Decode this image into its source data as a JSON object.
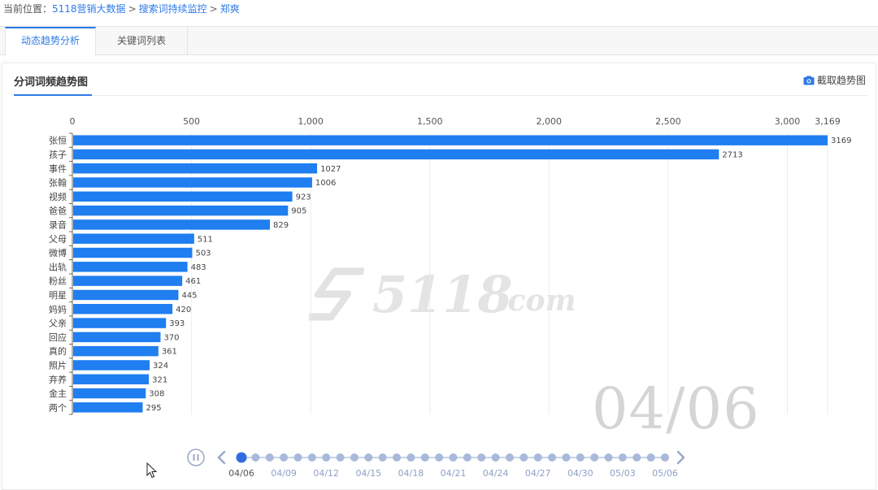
{
  "breadcrumb": {
    "prefix": "当前位置：",
    "items": [
      "5118营销大数据",
      "搜索词持续监控",
      "郑爽"
    ],
    "separator": ">"
  },
  "tabs": [
    {
      "label": "动态趋势分析",
      "active": true
    },
    {
      "label": "关键词列表",
      "active": false
    }
  ],
  "panel": {
    "title": "分词词频趋势图",
    "capture_label": "截取趋势图",
    "capture_icon": "camera-icon"
  },
  "watermark": {
    "brand": "5118",
    "suffix": ".com"
  },
  "colors": {
    "bar": "#1f7ef0",
    "accent": "#2d7ae6",
    "timeline_dot": "#a9b9da",
    "timeline_active": "#2f6de0"
  },
  "chart_data": {
    "type": "bar",
    "orientation": "horizontal",
    "categories": [
      "张恒",
      "孩子",
      "事件",
      "张翰",
      "视频",
      "爸爸",
      "录音",
      "父母",
      "微博",
      "出轨",
      "粉丝",
      "明星",
      "妈妈",
      "父亲",
      "回应",
      "真的",
      "照片",
      "弃养",
      "金主",
      "两个"
    ],
    "values": [
      3169,
      2713,
      1027,
      1006,
      923,
      905,
      829,
      511,
      503,
      483,
      461,
      445,
      420,
      393,
      370,
      361,
      324,
      321,
      308,
      295
    ],
    "xlim": [
      0,
      3169
    ],
    "xticks": [
      0,
      500,
      1000,
      1500,
      2000,
      2500,
      3000,
      3169
    ],
    "xtick_labels": [
      "0",
      "500",
      "1,000",
      "1,500",
      "2,000",
      "2,500",
      "3,000",
      "3,169"
    ],
    "grid": true,
    "axis_position": "top",
    "current_date": "04/06"
  },
  "timeline": {
    "dot_count": 31,
    "active_index": 0,
    "labels": [
      "04/06",
      "04/09",
      "04/12",
      "04/15",
      "04/18",
      "04/21",
      "04/24",
      "04/27",
      "04/30",
      "05/03",
      "05/06"
    ],
    "play_icon": "pause-icon",
    "prev_icon": "chevron-left-icon",
    "next_icon": "chevron-right-icon"
  }
}
